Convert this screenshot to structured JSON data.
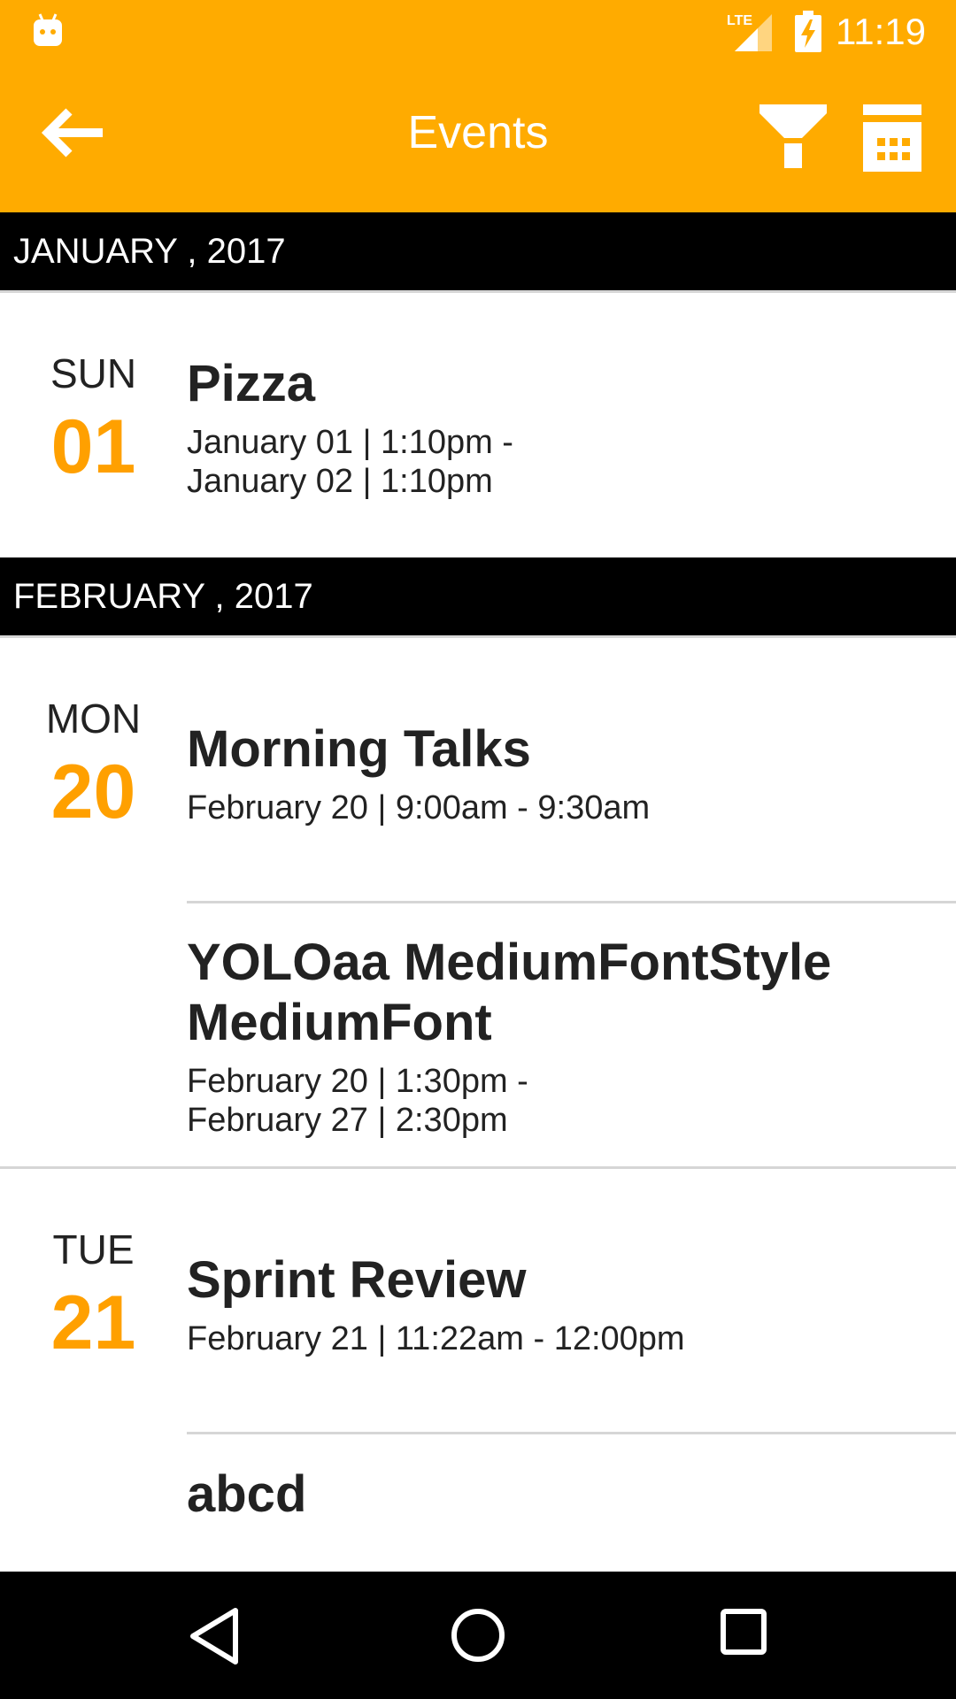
{
  "status_bar": {
    "network": "LTE",
    "time": "11:19",
    "icons": [
      "android-icon",
      "lte-signal-icon",
      "battery-charging-icon"
    ]
  },
  "toolbar": {
    "title": "Events",
    "icons": [
      "back-arrow-icon",
      "filter-icon",
      "calendar-icon"
    ]
  },
  "sections": [
    {
      "month": "JANUARY , 2017",
      "days": [
        {
          "day_name": "SUN",
          "day_number": "01",
          "events": [
            {
              "title": "Pizza",
              "time_line1": "January 01 | 1:10pm -",
              "time_line2": "January 02 | 1:10pm"
            }
          ]
        }
      ]
    },
    {
      "month": "FEBRUARY , 2017",
      "days": [
        {
          "day_name": "MON",
          "day_number": "20",
          "events": [
            {
              "title": "Morning Talks",
              "time_line1": "February 20 | 9:00am - 9:30am"
            },
            {
              "title_line1": "YOLOaa MediumFontStyle",
              "title_line2": "MediumFont",
              "time_line1": "February 20 | 1:30pm -",
              "time_line2": "February 27 | 2:30pm"
            }
          ]
        },
        {
          "day_name": "TUE",
          "day_number": "21",
          "events": [
            {
              "title": "Sprint Review",
              "time_line1": "February 21 | 11:22am - 12:00pm"
            },
            {
              "title": "abcd"
            }
          ]
        }
      ]
    }
  ],
  "nav_bar": {
    "icons": [
      "nav-back-icon",
      "nav-home-icon",
      "nav-recents-icon"
    ]
  },
  "colors": {
    "primary": "#FFAB00",
    "accent_date": "#FFA000",
    "month_header_bg": "#000000",
    "text": "#222222"
  }
}
